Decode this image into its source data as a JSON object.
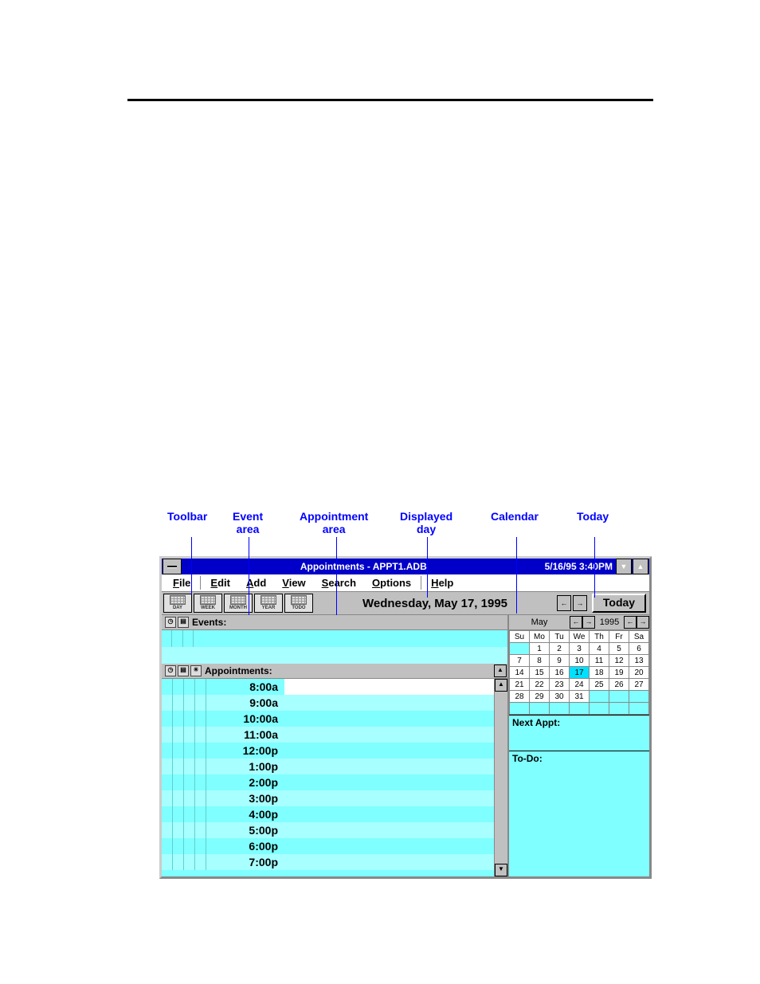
{
  "annotations": {
    "toolbar": "Toolbar",
    "event_area": "Event\narea",
    "appointment_area": "Appointment\narea",
    "displayed_day": "Displayed\nday",
    "calendar": "Calendar",
    "today": "Today"
  },
  "titlebar": {
    "title": "Appointments - APPT1.ADB",
    "datetime": "5/16/95  3:40PM",
    "min_glyph": "▼",
    "max_glyph": "▲"
  },
  "menu": {
    "items": [
      {
        "u": "F",
        "rest": "ile"
      },
      {
        "u": "E",
        "rest": "dit"
      },
      {
        "u": "A",
        "rest": "dd"
      },
      {
        "u": "V",
        "rest": "iew"
      },
      {
        "u": "S",
        "rest": "earch"
      },
      {
        "u": "O",
        "rest": "ptions"
      },
      {
        "u": "H",
        "rest": "elp"
      }
    ]
  },
  "toolbar": {
    "buttons": [
      "DAY",
      "WEEK",
      "MONTH",
      "YEAR",
      "TODO"
    ],
    "displayed_day": "Wednesday, May 17, 1995",
    "larrow": "←",
    "rarrow": "→",
    "today_label": "Today"
  },
  "events": {
    "heading": "Events:"
  },
  "appointments": {
    "heading": "Appointments:",
    "up": "▲",
    "down": "▼",
    "times": [
      "8:00a",
      "9:00a",
      "10:00a",
      "11:00a",
      "12:00p",
      "1:00p",
      "2:00p",
      "3:00p",
      "4:00p",
      "5:00p",
      "6:00p",
      "7:00p"
    ]
  },
  "calendar": {
    "month": "May",
    "year": "1995",
    "prev": "←",
    "next": "→",
    "days": [
      "Su",
      "Mo",
      "Tu",
      "We",
      "Th",
      "Fr",
      "Sa"
    ],
    "weeks": [
      [
        {
          "n": "",
          "out": true
        },
        {
          "n": "1"
        },
        {
          "n": "2"
        },
        {
          "n": "3"
        },
        {
          "n": "4"
        },
        {
          "n": "5"
        },
        {
          "n": "6"
        }
      ],
      [
        {
          "n": "7"
        },
        {
          "n": "8"
        },
        {
          "n": "9"
        },
        {
          "n": "10"
        },
        {
          "n": "11"
        },
        {
          "n": "12"
        },
        {
          "n": "13"
        }
      ],
      [
        {
          "n": "14"
        },
        {
          "n": "15"
        },
        {
          "n": "16"
        },
        {
          "n": "17",
          "sel": true
        },
        {
          "n": "18"
        },
        {
          "n": "19"
        },
        {
          "n": "20"
        }
      ],
      [
        {
          "n": "21"
        },
        {
          "n": "22"
        },
        {
          "n": "23"
        },
        {
          "n": "24"
        },
        {
          "n": "25"
        },
        {
          "n": "26"
        },
        {
          "n": "27"
        }
      ],
      [
        {
          "n": "28"
        },
        {
          "n": "29"
        },
        {
          "n": "30"
        },
        {
          "n": "31"
        },
        {
          "n": "",
          "out": true
        },
        {
          "n": "",
          "out": true
        },
        {
          "n": "",
          "out": true
        }
      ],
      [
        {
          "n": "",
          "out": true
        },
        {
          "n": "",
          "out": true
        },
        {
          "n": "",
          "out": true
        },
        {
          "n": "",
          "out": true
        },
        {
          "n": "",
          "out": true
        },
        {
          "n": "",
          "out": true
        },
        {
          "n": "",
          "out": true
        }
      ]
    ],
    "next_appt_label": "Next Appt:",
    "todo_label": "To-Do:"
  }
}
